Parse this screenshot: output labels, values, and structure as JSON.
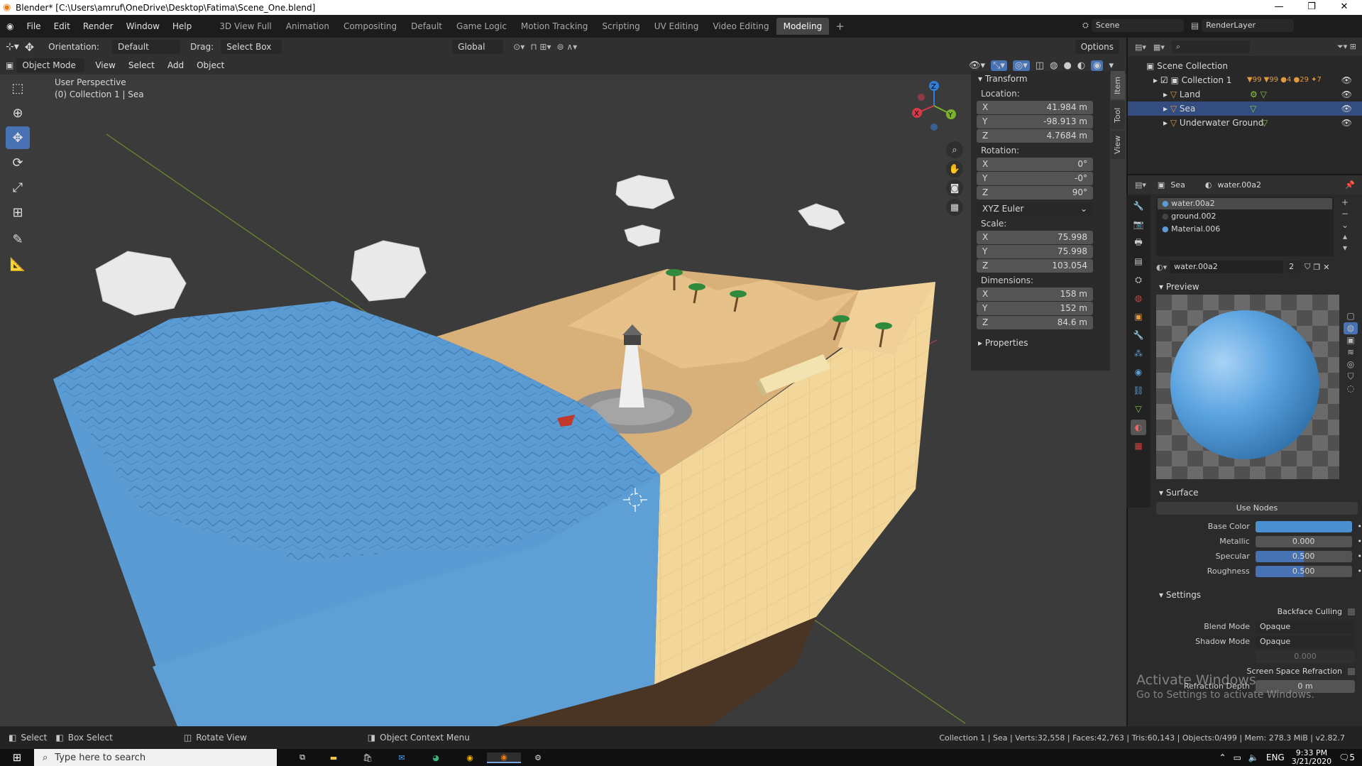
{
  "window": {
    "title": "Blender* [C:\\Users\\amruf\\OneDrive\\Desktop\\Fatima\\Scene_One.blend]"
  },
  "menu": {
    "items": [
      "File",
      "Edit",
      "Render",
      "Window",
      "Help"
    ]
  },
  "workspaces": [
    "3D View Full",
    "Animation",
    "Compositing",
    "Default",
    "Game Logic",
    "Motion Tracking",
    "Scripting",
    "UV Editing",
    "Video Editing",
    "Modeling"
  ],
  "workspace_active": "Modeling",
  "scene": {
    "name": "Scene",
    "render_layer": "RenderLayer"
  },
  "tool_header": {
    "orientation_label": "Orientation:",
    "orientation_value": "Default",
    "drag_label": "Drag:",
    "drag_value": "Select Box",
    "transform_orientation": "Global",
    "options": "Options"
  },
  "viewport_header": {
    "mode": "Object Mode",
    "menus": [
      "View",
      "Select",
      "Add",
      "Object"
    ]
  },
  "viewport": {
    "perspective": "User Perspective",
    "collection_info": "(0) Collection 1 | Sea"
  },
  "npanel": {
    "tabs": [
      "Item",
      "Tool",
      "View"
    ],
    "transform_title": "Transform",
    "location_label": "Location:",
    "location": [
      {
        "axis": "X",
        "value": "41.984 m"
      },
      {
        "axis": "Y",
        "value": "-98.913 m"
      },
      {
        "axis": "Z",
        "value": "4.7684 m"
      }
    ],
    "rotation_label": "Rotation:",
    "rotation": [
      {
        "axis": "X",
        "value": "0°"
      },
      {
        "axis": "Y",
        "value": "-0°"
      },
      {
        "axis": "Z",
        "value": "90°"
      }
    ],
    "rotation_mode": "XYZ Euler",
    "scale_label": "Scale:",
    "scale": [
      {
        "axis": "X",
        "value": "75.998"
      },
      {
        "axis": "Y",
        "value": "75.998"
      },
      {
        "axis": "Z",
        "value": "103.054"
      }
    ],
    "dimensions_label": "Dimensions:",
    "dimensions": [
      {
        "axis": "X",
        "value": "158 m"
      },
      {
        "axis": "Y",
        "value": "152 m"
      },
      {
        "axis": "Z",
        "value": "84.6 m"
      }
    ],
    "properties_title": "Properties"
  },
  "outliner": {
    "root": "Scene Collection",
    "collection": "Collection 1",
    "collection_counts": [
      "99",
      "99",
      "4",
      "29",
      "7"
    ],
    "objects": [
      "Land",
      "Sea",
      "Underwater Ground"
    ]
  },
  "properties": {
    "object": "Sea",
    "material": "water.00a2",
    "slots": [
      "water.00a2",
      "ground.002",
      "Material.006"
    ],
    "material_field": "water.00a2",
    "users": "2",
    "preview_title": "Preview",
    "surface_title": "Surface",
    "use_nodes": "Use Nodes",
    "surface_rows": [
      {
        "label": "Base Color",
        "value": "",
        "fill": 1.0
      },
      {
        "label": "Metallic",
        "value": "0.000",
        "fill": 0.0
      },
      {
        "label": "Specular",
        "value": "0.500",
        "fill": 0.5
      },
      {
        "label": "Roughness",
        "value": "0.500",
        "fill": 0.5
      }
    ],
    "settings_title": "Settings",
    "backface_culling": "Backface Culling",
    "blend_mode_label": "Blend Mode",
    "blend_mode": "Opaque",
    "shadow_mode_label": "Shadow Mode",
    "shadow_mode": "Opaque",
    "clip_threshold": "0.000",
    "ssr": "Screen Space Refraction",
    "refraction_depth_label": "Refraction Depth",
    "refraction_depth": "0 m"
  },
  "watermark": {
    "line1": "Activate Windows",
    "line2": "Go to Settings to activate Windows."
  },
  "statusbar": {
    "select": "Select",
    "box_select": "Box Select",
    "rotate_view": "Rotate View",
    "context_menu": "Object Context Menu",
    "stats": "Collection 1 | Sea | Verts:32,558 | Faces:42,763 | Tris:60,143 | Objects:0/499 | Mem: 278.3 MiB | v2.82.7"
  },
  "taskbar": {
    "search_placeholder": "Type here to search",
    "lang": "ENG",
    "time": "9:33 PM",
    "date": "3/21/2020",
    "notifications": "5"
  },
  "colors": {
    "accent": "#4772b3",
    "water": "#5a9bd3",
    "sand": "#f3d79a",
    "grid_x": "#c04050",
    "grid_y": "#7a9a30"
  }
}
